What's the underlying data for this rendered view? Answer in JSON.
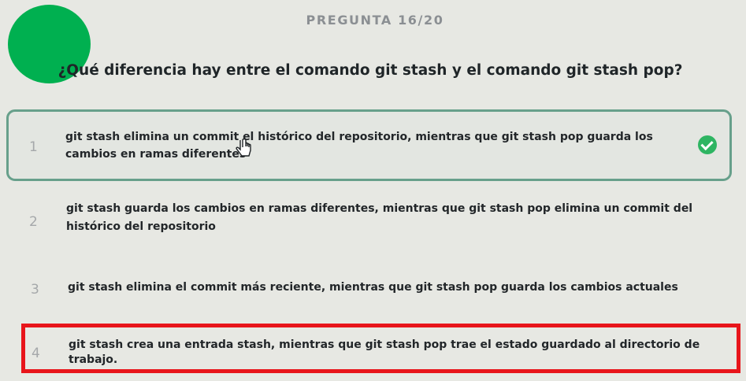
{
  "quiz": {
    "counter": "PREGUNTA 16/20",
    "question": "¿Qué diferencia hay entre el comando git stash y el comando git stash pop?",
    "options": [
      {
        "number": "1",
        "line1": "git stash elimina un commit el histórico del repositorio, mientras que git stash pop guarda los",
        "line2": "cambios en ramas diferentes"
      },
      {
        "number": "2",
        "line1": "git stash guarda los cambios en ramas diferentes, mientras que git stash pop elimina un commit del",
        "line2": "histórico del repositorio"
      },
      {
        "number": "3",
        "line1": "git stash elimina el commit más reciente, mientras que git stash pop guarda los cambios actuales"
      },
      {
        "number": "4",
        "line1": "git stash crea una entrada stash, mientras que git stash pop trae el estado guardado al directorio de trabajo."
      }
    ],
    "selected_option": "1",
    "highlighted_option": "4"
  },
  "colors": {
    "background": "#e7e8e3",
    "avatar": "#00b050",
    "selected_border": "#67a08b",
    "check": "#2eb562",
    "highlight_frame": "#e8151b"
  },
  "icons": {
    "selected_option": "check-circle-icon",
    "pointer": "hand-pointer-icon"
  }
}
